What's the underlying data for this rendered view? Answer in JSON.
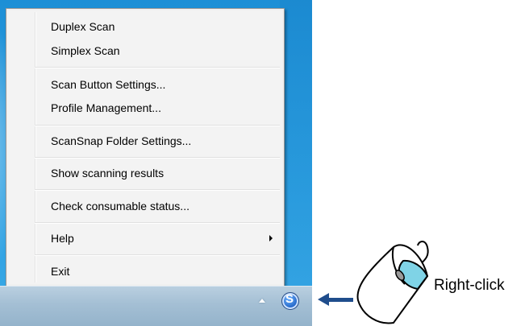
{
  "menu": {
    "items": [
      {
        "label": "Duplex Scan"
      },
      {
        "label": "Simplex Scan"
      },
      {
        "label": "Scan Button Settings..."
      },
      {
        "label": "Profile Management..."
      },
      {
        "label": "ScanSnap Folder Settings..."
      },
      {
        "label": "Show scanning results"
      },
      {
        "label": "Check consumable status..."
      },
      {
        "label": "Help",
        "has_submenu": true
      },
      {
        "label": "Exit"
      }
    ]
  },
  "taskbar": {
    "icons": [
      "tray-expand-arrow-icon",
      "scansnap-manager-icon"
    ],
    "scansnap_glyph": "S"
  },
  "callout": {
    "label": "Right-click",
    "arrow_color": "#1f4d8c",
    "mouse_button_highlight": "#7fd3e6"
  }
}
